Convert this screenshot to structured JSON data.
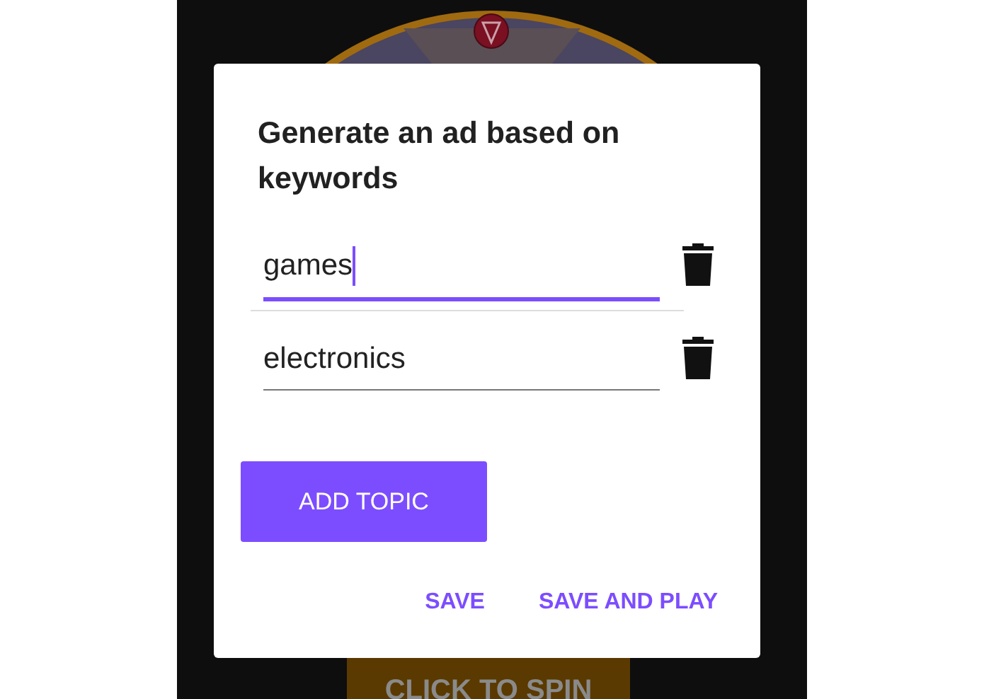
{
  "background_app": {
    "spin_button": "CLICK TO SPIN"
  },
  "dialog": {
    "title": "Generate an ad based on keywords",
    "keywords": [
      {
        "value": "games",
        "focused": true
      },
      {
        "value": "electronics",
        "focused": false
      }
    ],
    "add_button": "ADD TOPIC",
    "actions": [
      "SAVE",
      "SAVE AND PLAY"
    ]
  }
}
